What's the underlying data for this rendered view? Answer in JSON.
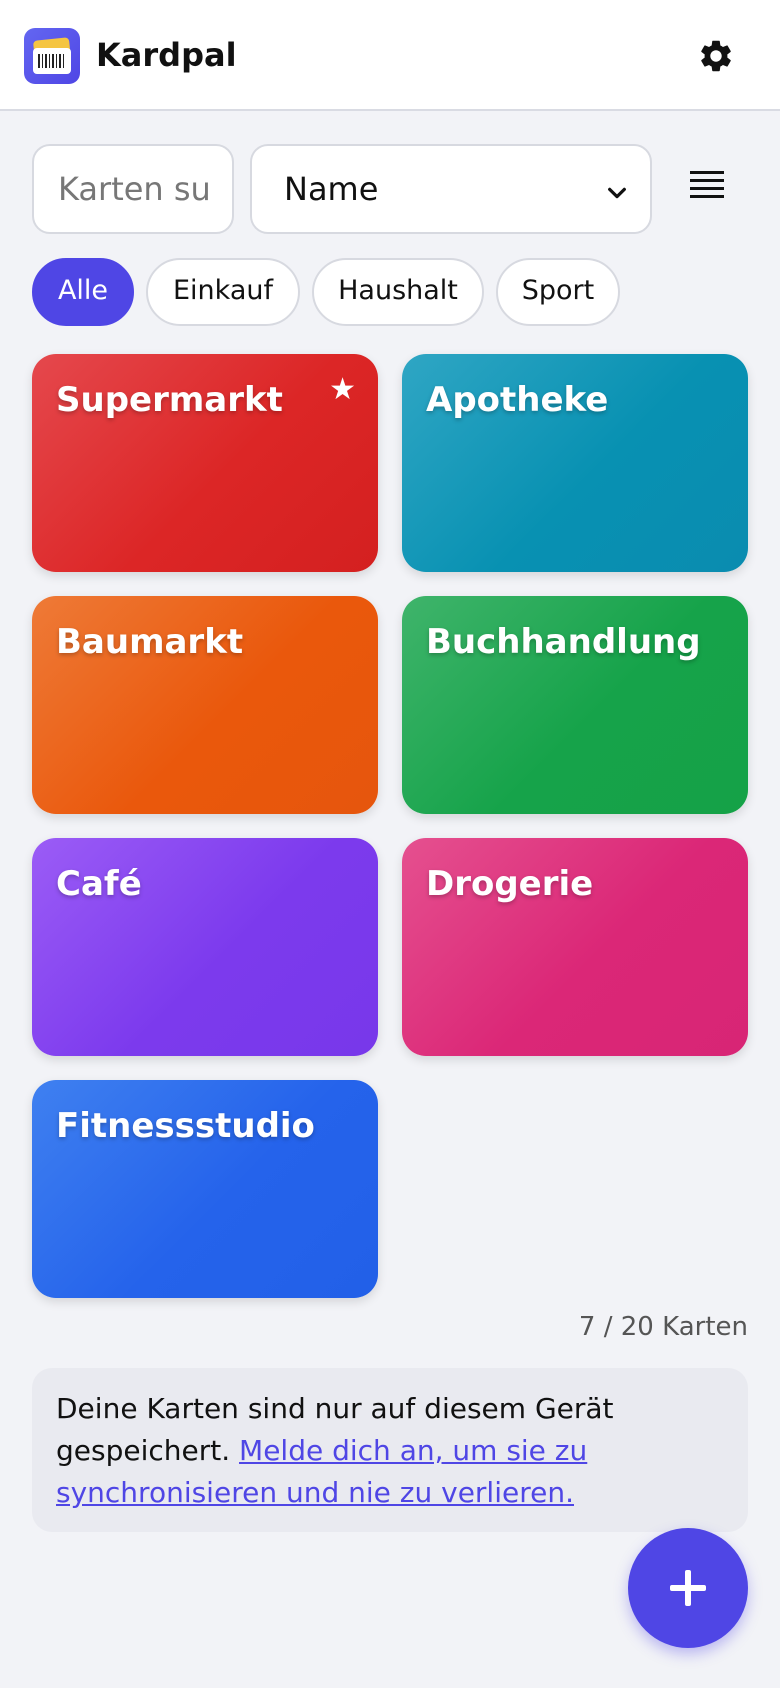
{
  "header": {
    "app_title": "Kardpal",
    "logo_icon": "wallet-card-icon",
    "settings_icon": "gear-icon"
  },
  "controls": {
    "search_placeholder": "Karten suchen",
    "search_value": "",
    "sort_selected": "Name",
    "view_toggle_icon": "list-view-icon"
  },
  "filters": [
    {
      "label": "Alle",
      "active": true
    },
    {
      "label": "Einkauf",
      "active": false
    },
    {
      "label": "Haushalt",
      "active": false
    },
    {
      "label": "Sport",
      "active": false
    }
  ],
  "cards": [
    {
      "name": "Supermarkt",
      "favorite": true,
      "color": "#dc2626"
    },
    {
      "name": "Apotheke",
      "favorite": false,
      "color": "#0891b2"
    },
    {
      "name": "Baumarkt",
      "favorite": false,
      "color": "#ea580c"
    },
    {
      "name": "Buchhandlung",
      "favorite": false,
      "color": "#16a34a"
    },
    {
      "name": "Café",
      "favorite": false,
      "color": "#7c3aed"
    },
    {
      "name": "Drogerie",
      "favorite": false,
      "color": "#db2777"
    },
    {
      "name": "Fitnessstudio",
      "favorite": false,
      "color": "#2563eb"
    }
  ],
  "favorite_symbol": "★",
  "card_count": "7 / 20 Karten",
  "notice": {
    "text": "Deine Karten sind nur auf diesem Gerät gespeichert.",
    "link": "Melde dich an, um sie zu synchronisieren und nie zu verlieren."
  },
  "fab_icon": "plus-icon",
  "colors": {
    "accent": "#4f46e5",
    "background": "#f2f3f7"
  }
}
